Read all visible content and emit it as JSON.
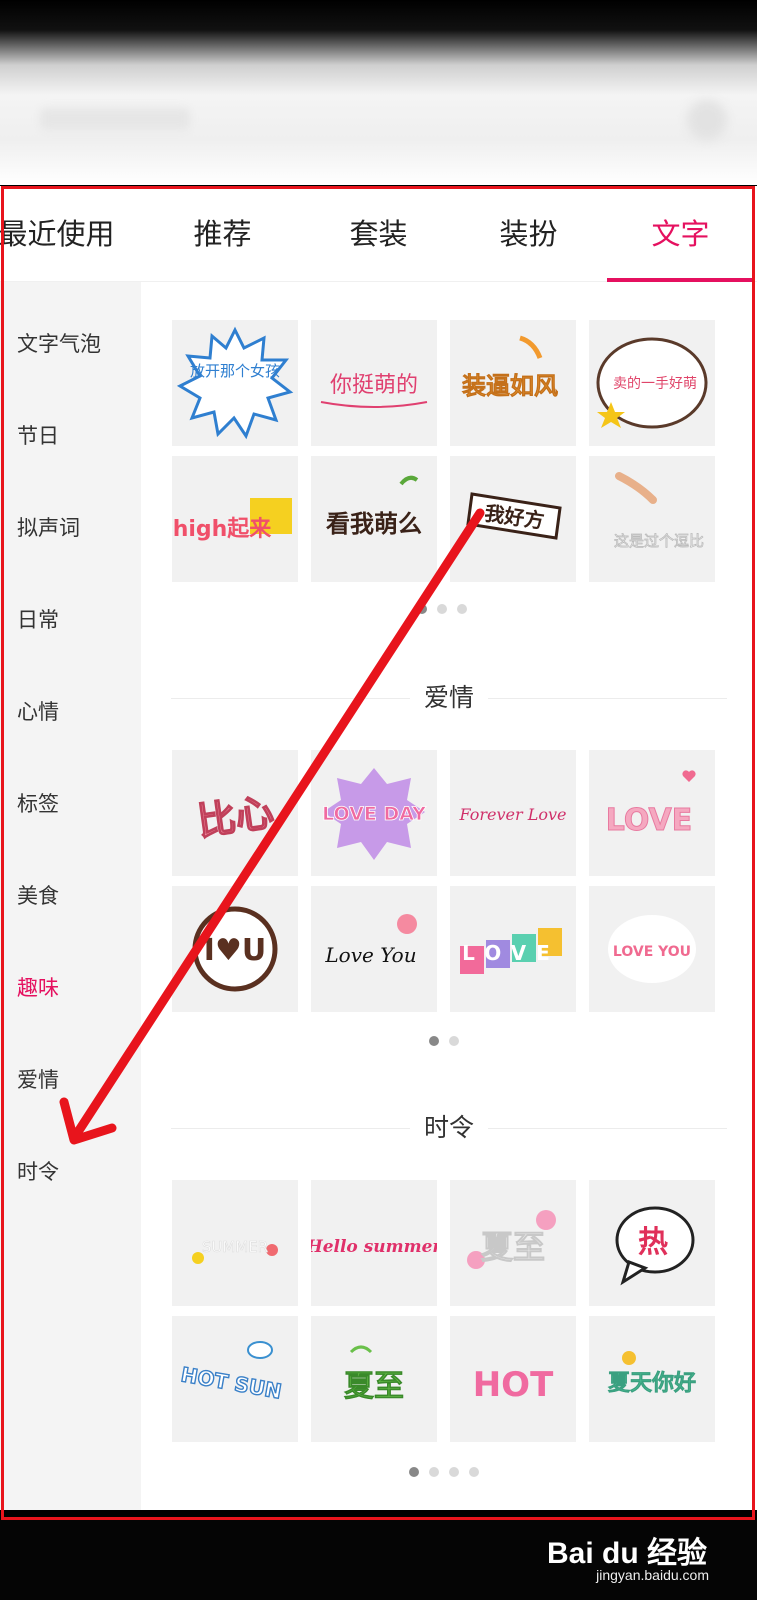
{
  "tabs": [
    {
      "label": "最近使用",
      "active": false
    },
    {
      "label": "推荐",
      "active": false
    },
    {
      "label": "套装",
      "active": false
    },
    {
      "label": "装扮",
      "active": false
    },
    {
      "label": "文字",
      "active": true
    }
  ],
  "sidebar": {
    "items": [
      {
        "label": "文字气泡",
        "active": false
      },
      {
        "label": "节日",
        "active": false
      },
      {
        "label": "拟声词",
        "active": false
      },
      {
        "label": "日常",
        "active": false
      },
      {
        "label": "心情",
        "active": false
      },
      {
        "label": "标签",
        "active": false
      },
      {
        "label": "美食",
        "active": false
      },
      {
        "label": "趣味",
        "active": true
      },
      {
        "label": "爱情",
        "active": false
      },
      {
        "label": "时令",
        "active": false
      }
    ]
  },
  "sections": [
    {
      "title": "",
      "stickers": [
        "放开那个女孩",
        "你挺萌的",
        "装逼如风",
        "卖的一手好萌",
        "high起来",
        "看我萌么",
        "我好方",
        "这是过个逗比"
      ],
      "pages": 3,
      "current_page": 1
    },
    {
      "title": "爱情",
      "stickers": [
        "比心",
        "LOVE DAY",
        "Forever Love",
        "LOVE",
        "I♥U",
        "Love You",
        "LOVE",
        "LOVE YOU"
      ],
      "pages": 2,
      "current_page": 1
    },
    {
      "title": "时令",
      "stickers": [
        "SUMMER",
        "Hello summer",
        "夏至",
        "热",
        "HOT SUN",
        "夏至",
        "HOT",
        "夏天你好"
      ],
      "pages": 4,
      "current_page": 1
    }
  ],
  "colors": {
    "accent": "#e5105f",
    "annotation_red": "#e8141c"
  },
  "watermark": {
    "text": "Bai du 经验",
    "sub": "jingyan.baidu.com"
  }
}
